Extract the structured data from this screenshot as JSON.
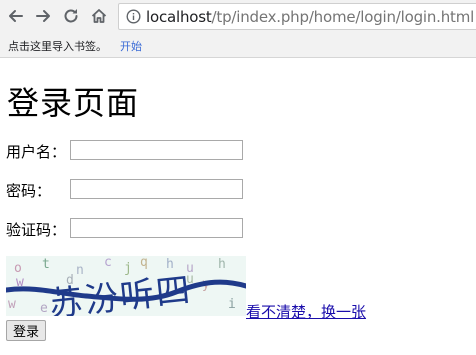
{
  "browser": {
    "url_host": "localhost",
    "url_path": "/tp/index.php/home/login/login.html",
    "bookmarks_prompt": "点击这里导入书签。",
    "bookmarks_start_link": "开始"
  },
  "page": {
    "title": "登录页面",
    "username_label": "用户名：",
    "password_label": "密码：",
    "captcha_label": "验证码：",
    "captcha_refresh_link": "看不清楚，换一张",
    "submit_label": "登录",
    "captcha_image": {
      "main_text": "苏汾听四",
      "noise_chars": "ontcjqhuhuyeiwed",
      "text_color": "#1f3a8a"
    }
  },
  "colors": {
    "omnibox_border": "#cfcfcf",
    "link": "#1a0dab",
    "bookmark_link": "#3b6bd6"
  }
}
